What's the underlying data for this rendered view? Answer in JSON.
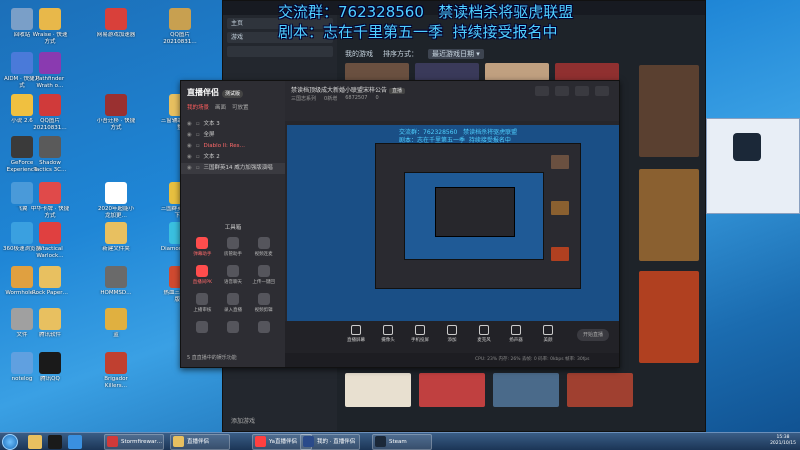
{
  "overlay": {
    "line1": "交流群：762328560   禁读档杀将驱虎联盟",
    "line2": "剧本：志在千里第五一季  持续接受报名中"
  },
  "desktop_icons": [
    {
      "label": "回收站",
      "color": "#7a9fc8"
    },
    {
      "label": "Wraise · 快速方式",
      "color": "#e8b84a"
    },
    {
      "label": "网易游戏加速器",
      "color": "#d9403a"
    },
    {
      "label": "QQ图片20210831…",
      "color": "#c8a050"
    },
    {
      "label": "AIDM · 快捷方式",
      "color": "#4a7ad9"
    },
    {
      "label": "Pathfinder Wrath o…",
      "color": "#8a3ab0"
    },
    {
      "label": "小说 2.6",
      "color": "#f0c040"
    },
    {
      "label": "QQ图片20210831…",
      "color": "#d03a3a"
    },
    {
      "label": "小吾迁移 · 快捷方式",
      "color": "#9a3030"
    },
    {
      "label": "三窗辅助修改完整",
      "color": "#e8c060"
    },
    {
      "label": "GeForce Experience",
      "color": "#3a3a3a"
    },
    {
      "label": "Shadow Tactics 3C…",
      "color": "#5a5a5a"
    },
    {
      "label": "飞翼",
      "color": "#4a9ad9"
    },
    {
      "label": "中华卡牌 · 快捷方式",
      "color": "#e04a4a"
    },
    {
      "label": "2020年超能小龙加更…",
      "color": "#ffffff"
    },
    {
      "label": "三国群英传版本下载",
      "color": "#e8c040"
    },
    {
      "label": "360极速浏览器",
      "color": "#3aa0e0"
    },
    {
      "label": "Wtactical Warlock…",
      "color": "#e04040"
    },
    {
      "label": "新建文件夹",
      "color": "#e8c060"
    },
    {
      "label": "DiamondCraft",
      "color": "#3ac0e0"
    },
    {
      "label": "Wormhole…",
      "color": "#e0a040"
    },
    {
      "label": "Rock Paper…",
      "color": "#e8c060"
    },
    {
      "label": "HOMMSD…",
      "color": "#6a6a6a"
    },
    {
      "label": "热血三国时代版…",
      "color": "#d04a30"
    },
    {
      "label": "文件",
      "color": "#a0a0a0"
    },
    {
      "label": "腾讯软件",
      "color": "#e8c060"
    },
    {
      "label": "蓝",
      "color": "#e0b040"
    },
    {
      "label": "notelog",
      "color": "#60a0e0"
    },
    {
      "label": "腾讯QQ",
      "color": "#1a1a1a"
    },
    {
      "label": "Brigador Killers…",
      "color": "#c04030"
    }
  ],
  "steam": {
    "side_items": [
      "主页",
      "游戏"
    ],
    "tabs": [
      "我的游戏",
      "排序方式：",
      "最近游戏日期 ▾"
    ],
    "add_game": "添加游戏"
  },
  "app": {
    "logo": "直播伴侣",
    "logo_badge": "测试版",
    "scene_tabs": [
      "我的场景",
      "画面",
      "可放置"
    ],
    "sources": [
      {
        "name": "文本 3",
        "kind": "normal"
      },
      {
        "name": "全屏",
        "kind": "normal"
      },
      {
        "name": "Diablo II: Res…",
        "kind": "red"
      },
      {
        "name": "文本 2",
        "kind": "normal"
      },
      {
        "name": "三国群英14 威力加强版演唱",
        "kind": "hl"
      }
    ],
    "tools_title": "工具箱",
    "tools": [
      {
        "label": "弹幕助手",
        "hot": true
      },
      {
        "label": "房管助手",
        "hot": false
      },
      {
        "label": "视频连麦",
        "hot": false
      },
      {
        "label": "直播间PK",
        "hot": true
      },
      {
        "label": "语音聊天",
        "hot": false
      },
      {
        "label": "上传一键回",
        "hot": false
      },
      {
        "label": "上播审核",
        "hot": false
      },
      {
        "label": "录入直播",
        "hot": false
      },
      {
        "label": "视频剪辑",
        "hot": false
      },
      {
        "label": "",
        "hot": false
      },
      {
        "label": "",
        "hot": false
      },
      {
        "label": "",
        "hot": false
      }
    ],
    "hint": "5 直直播中的娱乐功能",
    "title": "禁读档顶级成大新婚小联盟宋梓公告",
    "title_badge": "直播",
    "stats": [
      "三国志系列",
      "0新增",
      "6872507",
      "0"
    ],
    "preview_overlay": "交流群：762328560   禁读档杀将驱虎联盟\n剧本：志在千里第五一季  持续接受报名中",
    "controls": [
      "直播屏幕",
      "摄像头",
      "手机投屏",
      "添加",
      "麦克风",
      "扬声器",
      "美颜"
    ],
    "start_label": "开始直播",
    "status": "CPU: 23%   内存: 26%   丢帧: 0   码率: 0kbps   帧率: 30fps"
  },
  "taskbar": {
    "tasks": [
      {
        "label": "Stormfirewar…",
        "color": "#d03a3a"
      },
      {
        "label": "直播伴侣",
        "color": "#e8c060"
      },
      {
        "label": "Ya直播伴侣",
        "color": "#ff4040"
      },
      {
        "label": "我的 · 直播伴侣",
        "color": "#2a4a8a"
      },
      {
        "label": "Steam",
        "color": "#1b2838"
      }
    ],
    "time": "15:38",
    "date": "2021/10/15"
  }
}
